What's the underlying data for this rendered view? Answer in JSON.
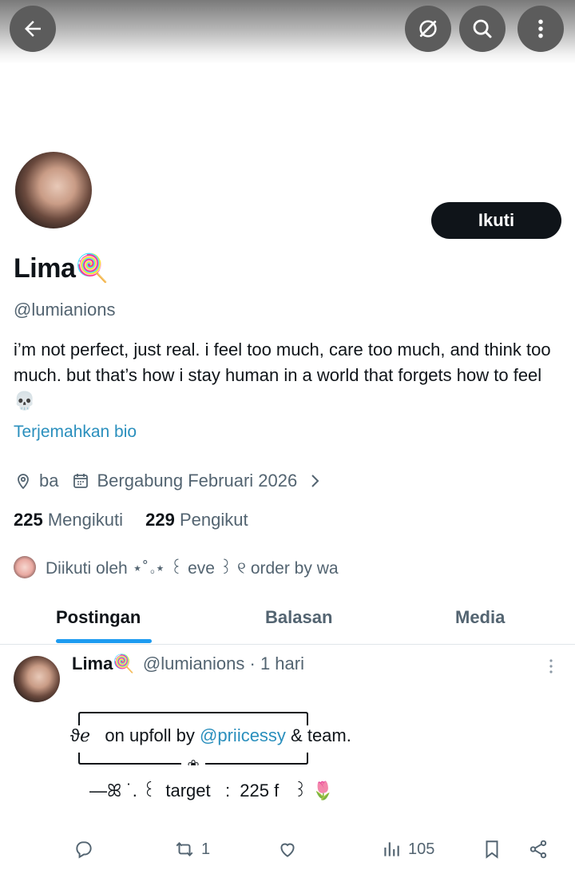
{
  "header": {
    "back_icon": "arrow-left-icon",
    "buttons": [
      "grok-icon",
      "search-icon",
      "more-vertical-icon"
    ]
  },
  "profile": {
    "display_name": "Lima",
    "name_emoji": "🍭",
    "handle": "@lumianions",
    "follow_label": "Ikuti",
    "bio": "i’m not perfect, just real. i feel too much, care too much, and think too much. but that’s how i stay human in a world that forgets how to feel 💀",
    "translate_label": "Terjemahkan bio",
    "location": "ba",
    "joined": "Bergabung Februari 2026",
    "following_count": "225",
    "following_label": "Mengikuti",
    "followers_count": "229",
    "followers_label": "Pengikut",
    "followed_by": "Diikuti oleh ⋆˚｡⋆ ꒰ eve ꒱ ୧ order by wa"
  },
  "tabs": [
    {
      "label": "Postingan",
      "active": true
    },
    {
      "label": "Balasan",
      "active": false
    },
    {
      "label": "Media",
      "active": false
    }
  ],
  "post": {
    "author": "Lima",
    "author_emoji": "🍭",
    "handle": "@lumianions",
    "time": "· 1 hari",
    "line1_prefix": "ϑℯ   on upfoll by ",
    "line1_mention": "@priicessy",
    "line1_suffix": " & team.",
    "line2": "—ꕤ ˙. ꒰  target   :  225 f   ꒱ 🌷",
    "retweets": "1",
    "views": "105"
  },
  "colors": {
    "accent": "#1d9bf0",
    "text_primary": "#0f1419",
    "text_secondary": "#536471",
    "follow_bg": "#0f1419"
  }
}
